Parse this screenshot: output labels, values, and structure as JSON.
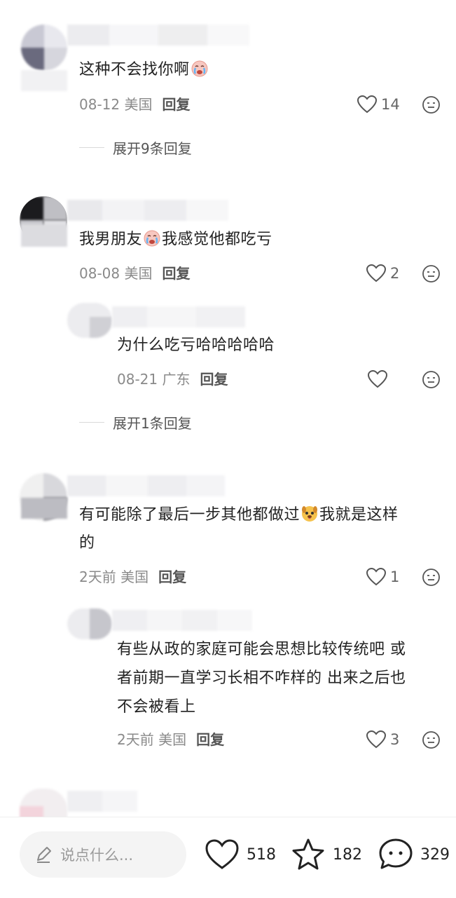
{
  "comments": [
    {
      "text": "这种不会找你啊",
      "emoji": "crying-emoji",
      "meta": "08-12 美国",
      "reply": "回复",
      "likes": "14",
      "expand": "展开9条回复"
    },
    {
      "text": "我男朋友",
      "emoji": "crying-emoji",
      "text_after": "我感觉他都吃亏",
      "meta": "08-08 美国",
      "reply": "回复",
      "likes": "2",
      "replies": [
        {
          "text": "为什么吃亏哈哈哈哈哈",
          "meta": "08-21 广东",
          "reply": "回复",
          "likes": ""
        }
      ],
      "expand": "展开1条回复"
    },
    {
      "text": "有可能除了最后一步其他都做过",
      "emoji": "dog-emoji",
      "text_after": "我就是这样",
      "text_line2": "的",
      "meta": "2天前 美国",
      "reply": "回复",
      "likes": "1",
      "replies": [
        {
          "text_line1": "有些从政的家庭可能会思想比较传统吧 或",
          "text_line2": "者前期一直学习长相不咋样的 出来之后也",
          "text_line3": "不会被看上",
          "meta": "2天前 美国",
          "reply": "回复",
          "likes": "3"
        }
      ]
    }
  ],
  "bottom_bar": {
    "input_placeholder": "说点什么...",
    "likes": "518",
    "favorites": "182",
    "comments": "329"
  },
  "colors": {
    "meta_gray": "#8a8a8a",
    "text": "#222222",
    "input_bg": "#f4f4f4"
  }
}
